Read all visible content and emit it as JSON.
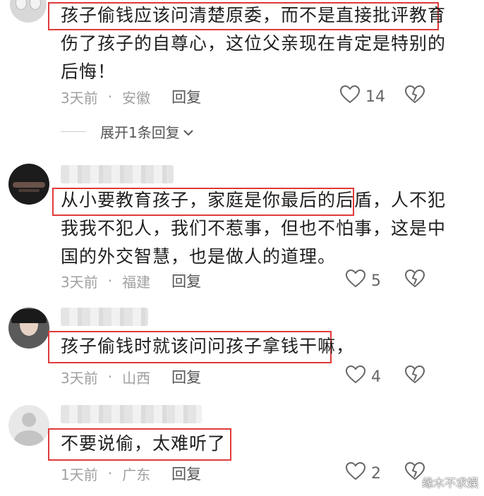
{
  "comments": [
    {
      "lines": [
        "孩子偷钱应该问清楚原委，而不是直接批评教育",
        "伤了孩子的自尊心，这位父亲现在肯定是特别的",
        "后悔！"
      ],
      "time": "3天前",
      "location": "安徽",
      "reply_label": "回复",
      "likes": "14",
      "expand_label": "展开1条回复"
    },
    {
      "lines": [
        "从小要教育孩子，家庭是你最后的后盾，人不犯",
        "我我不犯人，我们不惹事，但也不怕事，这是中",
        "国的外交智慧，也是做人的道理。"
      ],
      "time": "3天前",
      "location": "福建",
      "reply_label": "回复",
      "likes": "5"
    },
    {
      "lines": [
        "孩子偷钱时就该问问孩子拿钱干嘛，"
      ],
      "time": "3天前",
      "location": "山西",
      "reply_label": "回复",
      "likes": "4"
    },
    {
      "lines": [
        "不要说偷，太难听了"
      ],
      "time": "1天前",
      "location": "广东",
      "reply_label": "回复",
      "likes": "2"
    }
  ],
  "meta_separator": "·",
  "watermark": "缘木不求娱",
  "colors": {
    "highlight": "#e03a3a",
    "meta": "#a0a0a0"
  },
  "icons": {
    "like": "heart-outline-icon",
    "dislike": "broken-heart-icon",
    "expand": "chevron-down-icon"
  }
}
